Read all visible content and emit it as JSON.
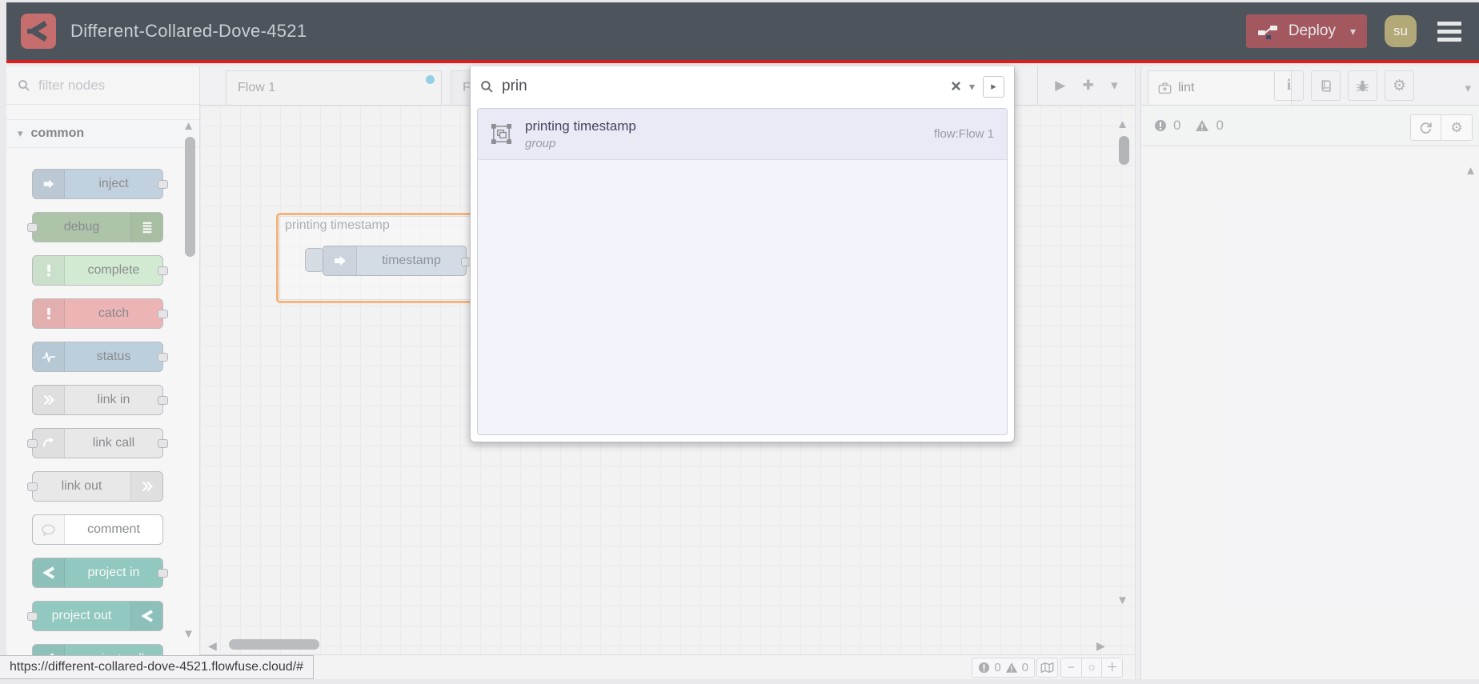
{
  "header": {
    "title": "Different-Collared-Dove-4521",
    "deploy_label": "Deploy",
    "avatar_initials": "su"
  },
  "colors": {
    "header_bg": "#4d545b",
    "accent_red": "#db1f21",
    "deploy_bg": "#a2585e",
    "avatar_bg": "#b3a878",
    "modified_dot": "#62b8d8",
    "group_highlight": "#f09140"
  },
  "palette": {
    "filter_placeholder": "filter nodes",
    "category": "common",
    "items": [
      {
        "label": "inject",
        "color": "#a6bbcf"
      },
      {
        "label": "debug",
        "color": "#87a980"
      },
      {
        "label": "complete",
        "color": "#bfe0bd"
      },
      {
        "label": "catch",
        "color": "#e49191"
      },
      {
        "label": "status",
        "color": "#9db9cc"
      },
      {
        "label": "link in",
        "color": "#dddddd"
      },
      {
        "label": "link call",
        "color": "#dddddd"
      },
      {
        "label": "link out",
        "color": "#dddddd"
      },
      {
        "label": "comment",
        "color": "#ffffff"
      },
      {
        "label": "project in",
        "color": "#5eaea1"
      },
      {
        "label": "project out",
        "color": "#5eaea1"
      },
      {
        "label": "project call",
        "color": "#5eaea1"
      }
    ]
  },
  "workspace": {
    "tabs": [
      {
        "label": "Flow 1",
        "modified": true
      },
      {
        "label": "Fl"
      }
    ],
    "group_label": "printing timestamp",
    "node_label": "timestamp"
  },
  "search": {
    "query": "prin",
    "results": [
      {
        "title": "printing timestamp",
        "subtitle": "group",
        "flow": "flow:Flow 1"
      }
    ]
  },
  "sidebar": {
    "tab_label": "lint",
    "error_count": "0",
    "warning_count": "0"
  },
  "canvas_footer": {
    "error_count": "0",
    "warning_count": "0"
  },
  "statusbar": {
    "url": "https://different-collared-dove-4521.flowfuse.cloud/#"
  }
}
